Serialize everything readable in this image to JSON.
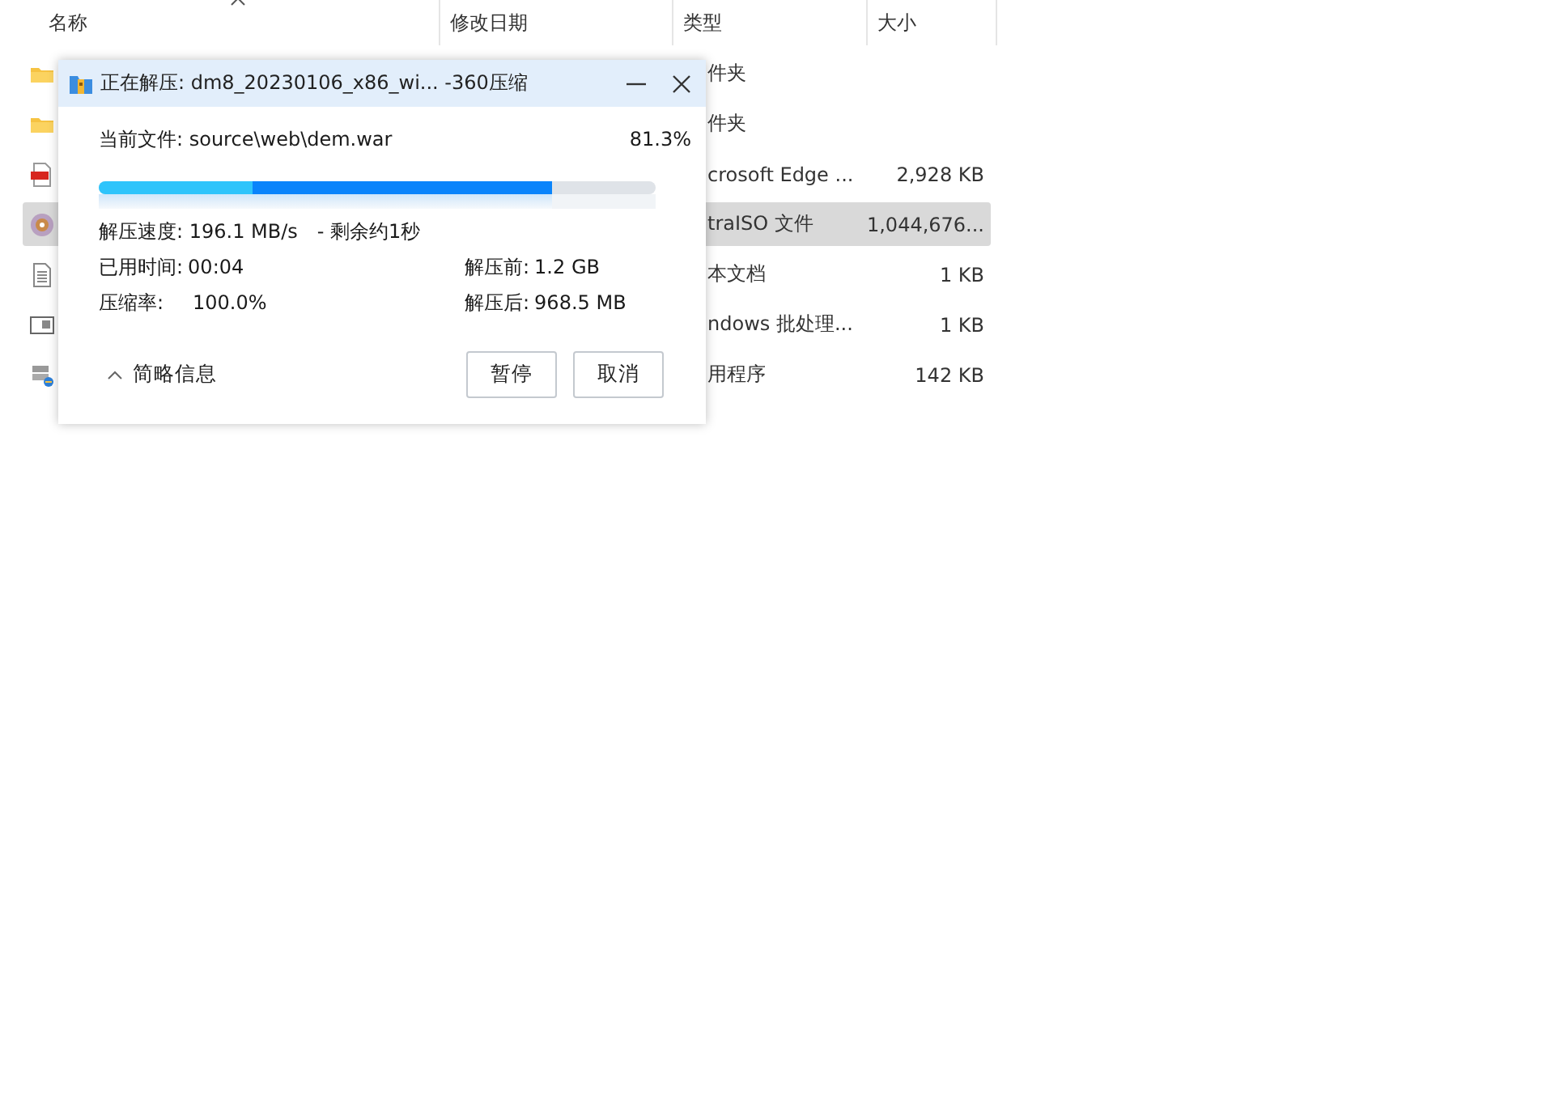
{
  "explorer": {
    "columns": [
      "名称",
      "修改日期",
      "类型",
      "大小"
    ],
    "rows": [
      {
        "kind": "folder",
        "type": "件夹",
        "size": "",
        "selected": false
      },
      {
        "kind": "folder",
        "type": "件夹",
        "size": "",
        "selected": false
      },
      {
        "kind": "pdf",
        "type": "crosoft Edge ...",
        "size": "2,928 KB",
        "selected": false
      },
      {
        "kind": "disc",
        "type": "traISO 文件",
        "size": "1,044,676...",
        "selected": true
      },
      {
        "kind": "text",
        "type": "本文档",
        "size": "1 KB",
        "selected": false
      },
      {
        "kind": "batch",
        "type": "ndows 批处理...",
        "size": "1 KB",
        "selected": false
      },
      {
        "kind": "installer",
        "type": "用程序",
        "size": "142 KB",
        "selected": false
      }
    ]
  },
  "dialog": {
    "title": "正在解压: dm8_20230106_x86_wi... -360压缩",
    "current_file": "当前文件: source\\web\\dem.war",
    "percent": "81.3%",
    "level": 0.813,
    "speed": "解压速度: 196.1 MB/s",
    "remaining": "- 剩余约1秒",
    "stats": [
      {
        "label": "已用时间:",
        "value": "00:04"
      },
      {
        "label": "解压前:",
        "value": "1.2 GB"
      },
      {
        "label": "压缩率:",
        "value": "100.0%"
      },
      {
        "label": "解压后:",
        "value": "968.5 MB"
      }
    ],
    "details_toggle": "简略信息",
    "buttons": [
      "暂停",
      "取消"
    ]
  }
}
